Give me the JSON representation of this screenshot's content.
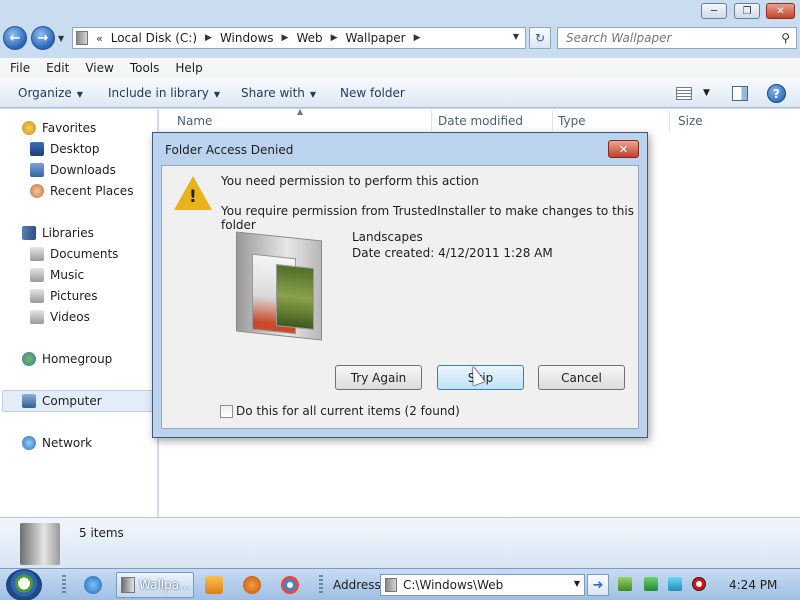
{
  "explorer": {
    "breadcrumb": [
      "Local Disk (C:)",
      "Windows",
      "Web",
      "Wallpaper"
    ],
    "search_placeholder": "Search Wallpaper",
    "menu": [
      "File",
      "Edit",
      "View",
      "Tools",
      "Help"
    ],
    "commands": [
      "Organize",
      "Include in library",
      "Share with",
      "New folder"
    ],
    "columns": [
      "Name",
      "Date modified",
      "Type",
      "Size"
    ],
    "status": "5 items"
  },
  "nav": {
    "favorites": "Favorites",
    "desktop": "Desktop",
    "downloads": "Downloads",
    "recent": "Recent Places",
    "libraries": "Libraries",
    "documents": "Documents",
    "music": "Music",
    "pictures": "Pictures",
    "videos": "Videos",
    "homegroup": "Homegroup",
    "computer": "Computer",
    "network": "Network"
  },
  "dialog": {
    "title": "Folder Access Denied",
    "heading": "You need permission to perform this action",
    "message": "You require permission from TrustedInstaller to make changes to this folder",
    "folder_name": "Landscapes",
    "date_created": "Date created: 4/12/2011 1:28 AM",
    "buttons": {
      "try_again": "Try Again",
      "skip": "Skip",
      "cancel": "Cancel"
    },
    "checkbox_label": "Do this for all current items (2 found)",
    "checkbox_checked": false
  },
  "taskbar": {
    "task_label": "Wallpa...",
    "address_label": "Address",
    "address_value": "C:\\Windows\\Web",
    "clock": "4:24 PM"
  },
  "colors": {
    "accent": "#2a64b7",
    "close_red": "#c2402a",
    "taskbar": "#9fbfe3"
  }
}
